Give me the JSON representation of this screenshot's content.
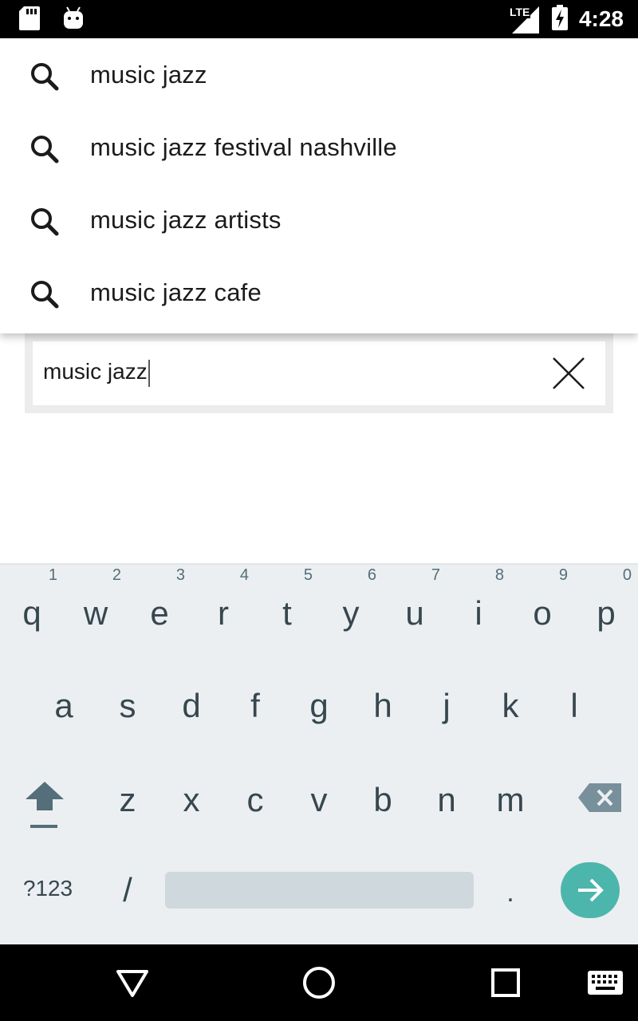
{
  "status_bar": {
    "time": "4:28",
    "network_label": "LTE",
    "icons": [
      "sd-card-icon",
      "android-icon",
      "lte-signal-icon",
      "battery-charging-icon"
    ]
  },
  "suggestions": [
    "music jazz",
    "music jazz festival nashville",
    "music jazz artists",
    "music jazz cafe"
  ],
  "search": {
    "value": "music jazz",
    "clear_icon": "close-icon"
  },
  "keyboard": {
    "row1": [
      {
        "letter": "q",
        "hint": "1"
      },
      {
        "letter": "w",
        "hint": "2"
      },
      {
        "letter": "e",
        "hint": "3"
      },
      {
        "letter": "r",
        "hint": "4"
      },
      {
        "letter": "t",
        "hint": "5"
      },
      {
        "letter": "y",
        "hint": "6"
      },
      {
        "letter": "u",
        "hint": "7"
      },
      {
        "letter": "i",
        "hint": "8"
      },
      {
        "letter": "o",
        "hint": "9"
      },
      {
        "letter": "p",
        "hint": "0"
      }
    ],
    "row2": [
      "a",
      "s",
      "d",
      "f",
      "g",
      "h",
      "j",
      "k",
      "l"
    ],
    "row3": [
      "z",
      "x",
      "c",
      "v",
      "b",
      "n",
      "m"
    ],
    "symbols_label": "?123",
    "slash_label": "/",
    "period_label": ".",
    "go_color": "#4db6ac",
    "key_color": "#37474f",
    "background_color": "#eceff1"
  },
  "nav_bar": {
    "icons": [
      "back-icon",
      "home-icon",
      "recents-icon",
      "keyboard-switch-icon"
    ]
  }
}
